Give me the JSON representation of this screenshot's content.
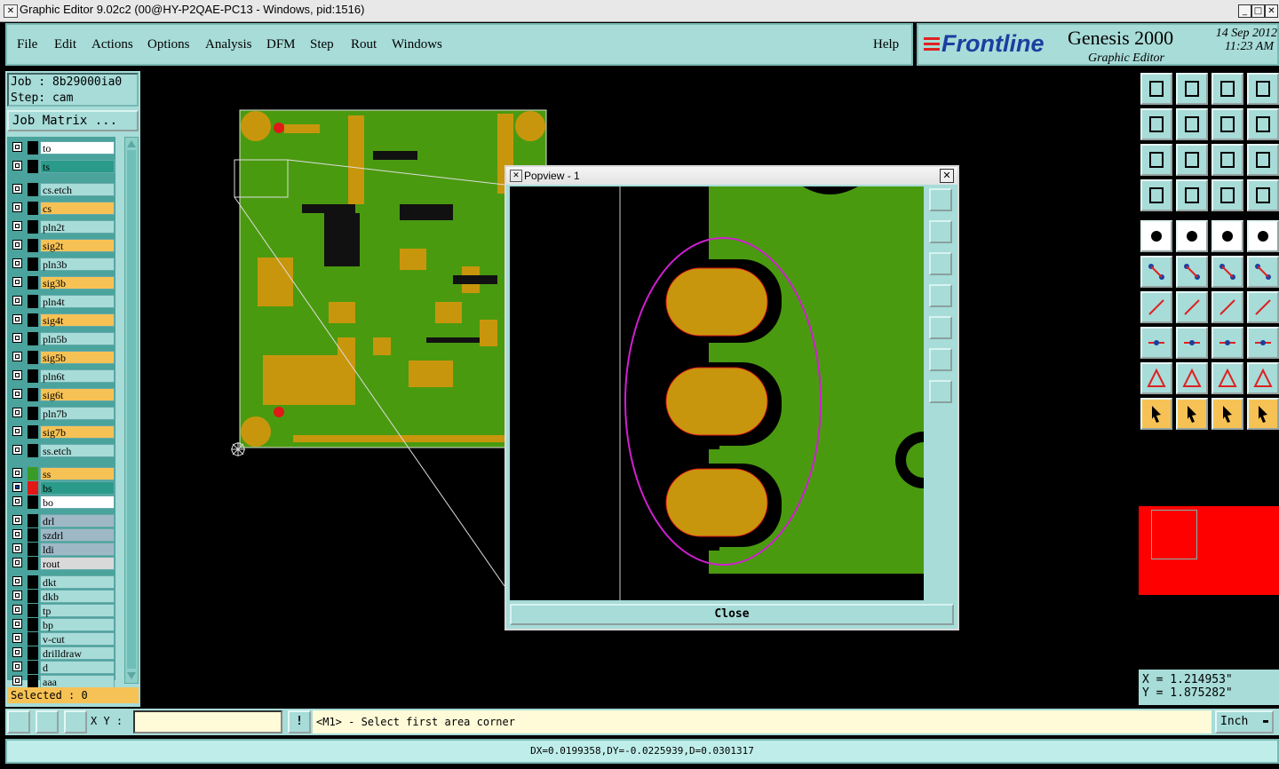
{
  "window": {
    "title": "Graphic Editor 9.02c2 (00@HY-P2QAE-PC13 - Windows, pid:1516)"
  },
  "menu": {
    "items": [
      "File",
      "Edit",
      "Actions",
      "Options",
      "Analysis",
      "DFM",
      "Step",
      "Rout",
      "Windows"
    ],
    "help": "Help"
  },
  "brand": {
    "logo": "Frontline",
    "product": "Genesis 2000",
    "subtitle": "Graphic Editor",
    "date": "14 Sep 2012",
    "time": "11:23 AM"
  },
  "job": {
    "job_line": "Job : 8b29000ia0",
    "step_line": "Step: cam",
    "matrix_button": "Job Matrix ..."
  },
  "layers": [
    {
      "name": "to",
      "color": "#ffffff",
      "swatch": "#000000"
    },
    {
      "name": "ts",
      "color": "#2a9b8a",
      "swatch": "#000000"
    },
    {
      "name": "cs.etch",
      "color": "#a7dcd8",
      "swatch": "#000000"
    },
    {
      "name": "cs",
      "color": "#f7c255",
      "swatch": "#000000"
    },
    {
      "name": "pln2t",
      "color": "#a7dcd8",
      "swatch": "#000000"
    },
    {
      "name": "sig2t",
      "color": "#f7c255",
      "swatch": "#000000"
    },
    {
      "name": "pln3b",
      "color": "#a7dcd8",
      "swatch": "#000000"
    },
    {
      "name": "sig3b",
      "color": "#f7c255",
      "swatch": "#000000"
    },
    {
      "name": "pln4t",
      "color": "#a7dcd8",
      "swatch": "#000000"
    },
    {
      "name": "sig4t",
      "color": "#f7c255",
      "swatch": "#000000"
    },
    {
      "name": "pln5b",
      "color": "#a7dcd8",
      "swatch": "#000000"
    },
    {
      "name": "sig5b",
      "color": "#f7c255",
      "swatch": "#000000"
    },
    {
      "name": "pln6t",
      "color": "#a7dcd8",
      "swatch": "#000000"
    },
    {
      "name": "sig6t",
      "color": "#f7c255",
      "swatch": "#000000"
    },
    {
      "name": "pln7b",
      "color": "#a7dcd8",
      "swatch": "#000000"
    },
    {
      "name": "sig7b",
      "color": "#f7c255",
      "swatch": "#000000"
    },
    {
      "name": "ss.etch",
      "color": "#a7dcd8",
      "swatch": "#000000"
    },
    {
      "name": "ss",
      "color": "#f7c255",
      "swatch": "#3a9b28",
      "active": true
    },
    {
      "name": "bs",
      "color": "#2a9b8a",
      "swatch": "#e01818",
      "active": true
    },
    {
      "name": "bo",
      "color": "#ffffff",
      "swatch": "#000000"
    },
    {
      "name": "drl",
      "color": "#9fb8c6",
      "swatch": "#000000"
    },
    {
      "name": "szdrl",
      "color": "#9fb8c6",
      "swatch": "#000000"
    },
    {
      "name": "ldi",
      "color": "#9fb8c6",
      "swatch": "#000000"
    },
    {
      "name": "rout",
      "color": "#d9d9d9",
      "swatch": "#000000"
    },
    {
      "name": "dkt",
      "color": "#a7dcd8",
      "swatch": "#000000"
    },
    {
      "name": "dkb",
      "color": "#a7dcd8",
      "swatch": "#000000"
    },
    {
      "name": "tp",
      "color": "#a7dcd8",
      "swatch": "#000000"
    },
    {
      "name": "bp",
      "color": "#a7dcd8",
      "swatch": "#000000"
    },
    {
      "name": "v-cut",
      "color": "#a7dcd8",
      "swatch": "#000000"
    },
    {
      "name": "drilldraw",
      "color": "#a7dcd8",
      "swatch": "#000000"
    },
    {
      "name": "d",
      "color": "#a7dcd8",
      "swatch": "#000000"
    },
    {
      "name": "aaa",
      "color": "#a7dcd8",
      "swatch": "#000000"
    }
  ],
  "selected_text": "Selected : 0",
  "popview": {
    "title": "Popview - 1",
    "close_label": "Close"
  },
  "coords": {
    "x": "X = 1.214953\"",
    "y": "Y = 1.875282\""
  },
  "bottom": {
    "xy_label": "X Y :",
    "xy_value": "",
    "prompt": "<M1> - Select first area corner",
    "unit": "Inch"
  },
  "status": "DX=0.0199358,DY=-0.0225939,D=0.0301317",
  "colors": {
    "panel": "#a7dcd8",
    "copper": "#4a9a10",
    "pad": "#c8960c",
    "highlight": "#d01fd0",
    "accent_red": "#ff0000"
  }
}
